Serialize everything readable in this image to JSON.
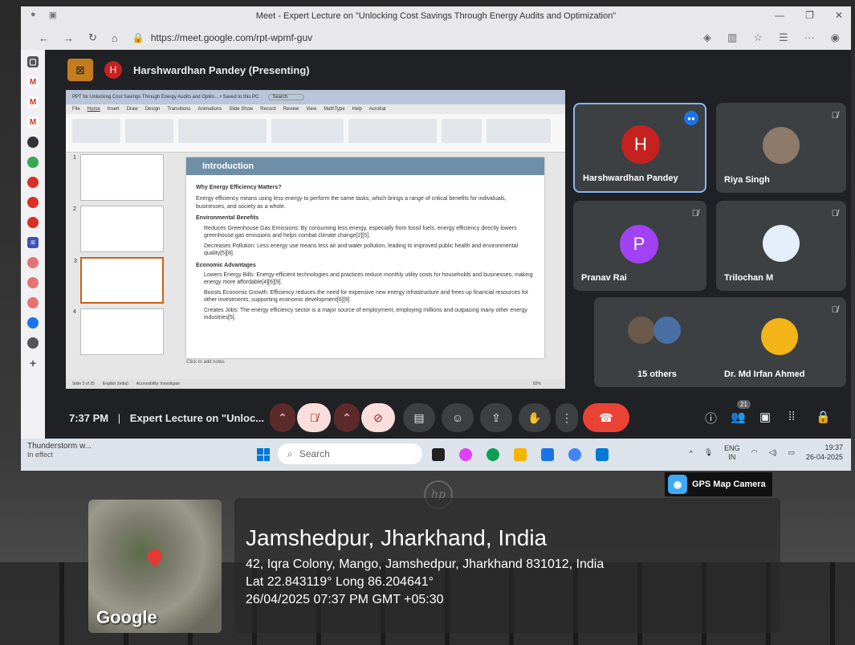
{
  "browser": {
    "window_title": "Meet - Expert Lecture on \"Unlocking Cost Savings Through Energy Audits and Optimization\"",
    "url": "https://meet.google.com/rpt-wpmf-guv"
  },
  "meet": {
    "presenter": "Harshwardhan Pandey (Presenting)",
    "presenter_initial": "H",
    "time": "7:37 PM",
    "meeting_title": "Expert Lecture on \"Unloc...",
    "participants_count": "21",
    "tiles": [
      {
        "name": "Harshwardhan Pandey",
        "initial": "H",
        "color": "#c5221f"
      },
      {
        "name": "Riya Singh"
      },
      {
        "name": "Pranav Rai",
        "initial": "P",
        "color": "#a142f4"
      },
      {
        "name": "Trilochan M"
      },
      {
        "name": "15 others"
      },
      {
        "name": "Dr. Md Irfan Ahmed"
      }
    ]
  },
  "slide": {
    "title": "Introduction",
    "heading": "Why Energy Efficiency Matters?",
    "intro": "Energy efficiency means using less energy to perform the same tasks, which brings a range of critical benefits for individuals, businesses, and society as a whole.",
    "env_heading": "Environmental Benefits",
    "env_1": "Reduces Greenhouse Gas Emissions: By consuming less energy, especially from fossil fuels, energy efficiency directly lowers greenhouse gas emissions and helps combat climate change[2][5].",
    "env_2": "Decreases Pollution: Less energy use means less air and water pollution, leading to improved public health and environmental quality[5][8].",
    "eco_heading": "Economic Advantages",
    "eco_1": "Lowers Energy Bills: Energy-efficient technologies and practices reduce monthly utility costs for households and businesses, making energy more affordable[4][6][9].",
    "eco_2": "Boosts Economic Growth: Efficiency reduces the need for expensive new energy infrastructure and frees up financial resources for other investments, supporting economic development[6][9].",
    "eco_3": "Creates Jobs: The energy efficiency sector is a major source of employment, employing millions and outpacing many other energy industries[5].",
    "notes": "Click to add notes",
    "ppt_title": "PPT for Unlocking Cost Savings Through Energy Audits and Optim... • Saved to this PC",
    "ppt_search": "Search",
    "ribbon_tabs": [
      "File",
      "Home",
      "Insert",
      "Draw",
      "Design",
      "Transitions",
      "Animations",
      "Slide Show",
      "Record",
      "Review",
      "View",
      "MathType",
      "Help",
      "Acrobat"
    ],
    "status_left": "Slide 3 of 25",
    "status_lang": "English (India)",
    "status_access": "Accessibility: Investigate",
    "zoom": "83%"
  },
  "taskbar": {
    "weather_title": "Thunderstorm w...",
    "weather_sub": "In effect",
    "search_placeholder": "Search",
    "lang": "ENG",
    "lang_sub": "IN",
    "clock_time": "19:37",
    "clock_date": "26-04-2025"
  },
  "gps": {
    "badge": "GPS Map Camera",
    "city": "Jamshedpur, Jharkhand, India",
    "address": "42, Iqra Colony, Mango, Jamshedpur, Jharkhand 831012, India",
    "coords": "Lat 22.843119° Long 86.204641°",
    "datetime": "26/04/2025 07:37 PM GMT +05:30",
    "map_brand": "Google"
  }
}
